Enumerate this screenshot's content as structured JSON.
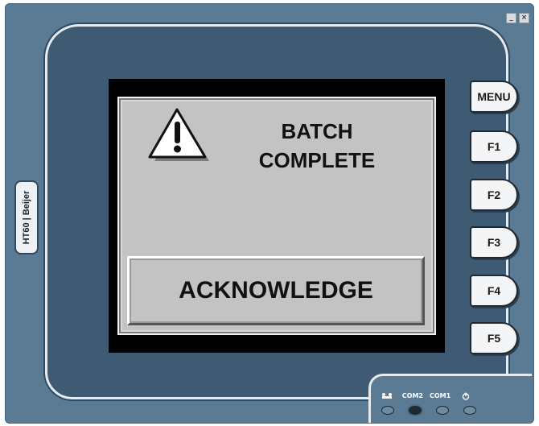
{
  "window": {
    "minimize_label": "_",
    "close_label": "×"
  },
  "device": {
    "brand": "HT60 | Beijer"
  },
  "screen": {
    "title_line_1": "BATCH",
    "title_line_2": "COMPLETE",
    "ack_label": "ACKNOWLEDGE",
    "warning_icon": "warning-triangle-icon"
  },
  "function_keys": [
    {
      "label": "MENU"
    },
    {
      "label": "F1"
    },
    {
      "label": "F2"
    },
    {
      "label": "F3"
    },
    {
      "label": "F4"
    },
    {
      "label": "F5"
    }
  ],
  "status_leds": [
    {
      "label": "RUN",
      "icon": "run-icon",
      "on": false
    },
    {
      "label": "COM2",
      "on": true
    },
    {
      "label": "COM1",
      "on": false
    },
    {
      "label": "",
      "icon": "power-icon",
      "on": false
    }
  ],
  "colors": {
    "plate": "#5b7a93",
    "bezel": "#3e5b73",
    "screen_bg": "#c3c3c3"
  }
}
